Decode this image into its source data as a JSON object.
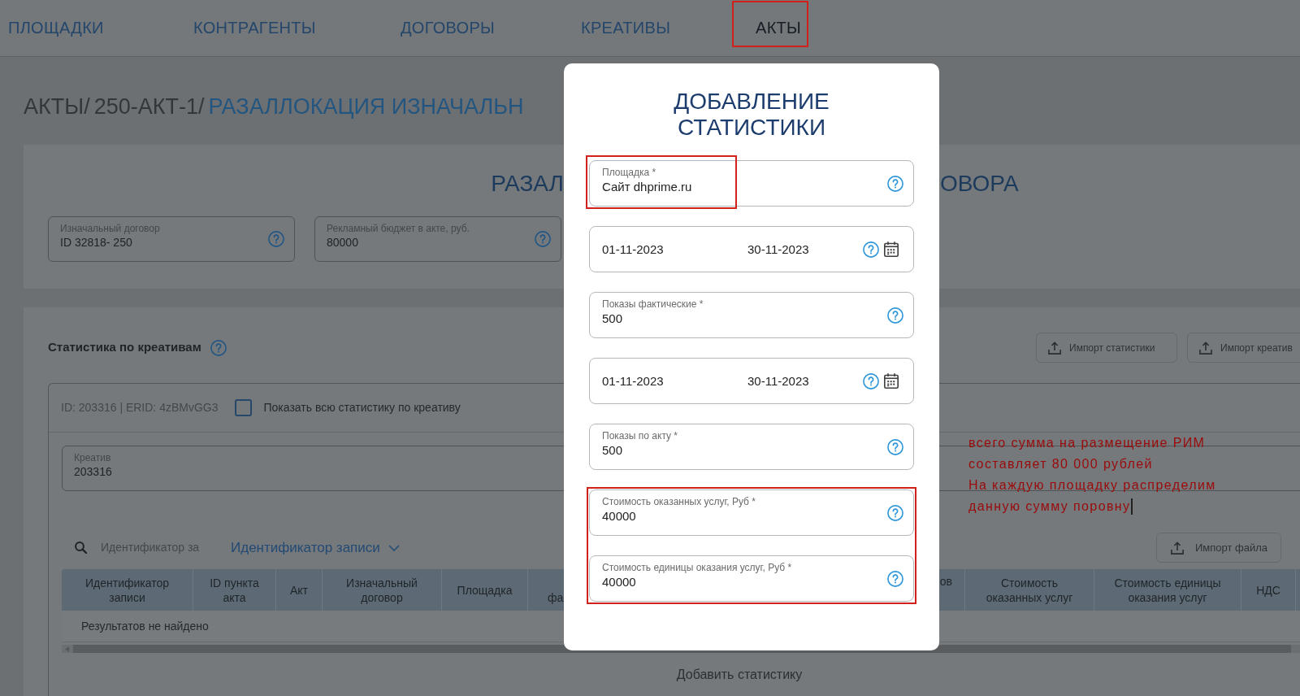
{
  "nav": {
    "tabs": [
      {
        "label": "ПЛОЩАДКИ",
        "selected": false,
        "annotated": false
      },
      {
        "label": "КОНТРАГЕНТЫ",
        "selected": false,
        "annotated": false
      },
      {
        "label": "ДОГОВОРЫ",
        "selected": false,
        "annotated": false
      },
      {
        "label": "КРЕАТИВЫ",
        "selected": false,
        "annotated": false
      },
      {
        "label": "АКТЫ",
        "selected": true,
        "annotated": true
      }
    ]
  },
  "breadcrumb": [
    {
      "label": "АКТЫ/",
      "kind": "link"
    },
    {
      "label": "250-АКТ-1/",
      "kind": "link"
    },
    {
      "label": "РАЗАЛЛОКАЦИЯ ИЗНАЧАЛЬН",
      "kind": "current"
    }
  ],
  "summary_card": {
    "title_left": "РАЗАЛ",
    "title_right": "ОВОРА",
    "fields": [
      {
        "label": "Изначальный договор",
        "value": "ID 32818- 250",
        "help": true
      },
      {
        "label": "Рекламный бюджет в акте, руб.",
        "value": "80000",
        "help": true
      }
    ]
  },
  "statistics": {
    "title": "Статистика по креативам",
    "buttons": [
      "Импорт статистики",
      "Импорт креатив"
    ],
    "creative": {
      "header": "ID: 203316 | ERID: 4zBMvGG3",
      "show_all": {
        "label": "Показать всю статистику по креативу",
        "checked": false
      },
      "field": {
        "label": "Креатив",
        "value": "203316",
        "help": false
      },
      "search": {
        "placeholder": "Идентификатор за"
      },
      "search_by": "Идентификатор записи",
      "import_button": "Импорт файла",
      "table": {
        "columns": [
          "Идентификатор записи",
          "ID пункта акта",
          "Акт",
          "Изначальный договор",
          "Площадка",
          "фа",
          "ов",
          "Стоимость оказанных услуг",
          "Стоимость единицы оказания услуг",
          "НДС"
        ],
        "empty_message": "Результатов не найдено"
      },
      "add_button": "Добавить статистику"
    }
  },
  "modal": {
    "title": "ДОБАВЛЕНИЕ СТАТИСТИКИ",
    "fields": [
      {
        "kind": "text",
        "label": "Площадка *",
        "value": "Сайт dhprime.ru",
        "annotated": true
      },
      {
        "kind": "date_range",
        "from": "01-11-2023",
        "to": "30-11-2023",
        "annotated": false
      },
      {
        "kind": "text",
        "label": "Показы фактические *",
        "value": "500",
        "annotated": false
      },
      {
        "kind": "date_range",
        "from": "01-11-2023",
        "to": "30-11-2023",
        "annotated": false
      },
      {
        "kind": "text",
        "label": "Показы по акту *",
        "value": "500",
        "annotated": false
      },
      {
        "kind": "text",
        "label": "Стоимость оказанных услуг, Руб *",
        "value": "40000",
        "annotated": true
      },
      {
        "kind": "text",
        "label": "Стоимость единицы оказания услуг, Руб *",
        "value": "40000",
        "annotated": true
      }
    ]
  },
  "annotation": {
    "lines": [
      "всего сумма на размещение РИМ",
      "составляет 80 000 рублей",
      "На каждую площадку распределим",
      "данную сумму поровну"
    ],
    "cursor": true
  }
}
